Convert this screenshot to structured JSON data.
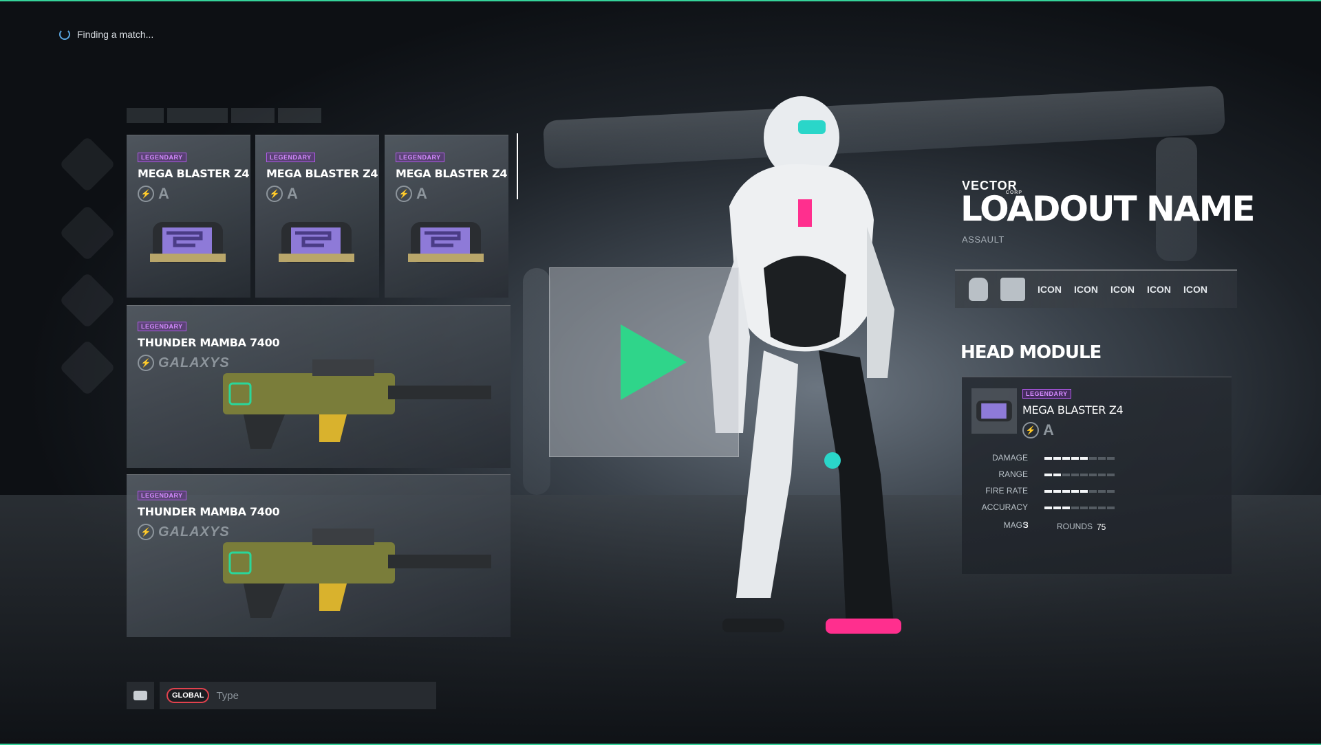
{
  "status": {
    "text": "Finding a match..."
  },
  "tabs": [
    "",
    "",
    "",
    ""
  ],
  "weapons": [
    {
      "rarity": "LEGENDARY",
      "name": "MEGA BLASTER Z4",
      "brand_letter": "A"
    },
    {
      "rarity": "LEGENDARY",
      "name": "MEGA BLASTER Z4",
      "brand_letter": "A"
    },
    {
      "rarity": "LEGENDARY",
      "name": "MEGA BLASTER Z4",
      "brand_letter": "A"
    },
    {
      "rarity": "LEGENDARY",
      "name": "THUNDER MAMBA 7400",
      "brand_logo": "GALAXYS"
    },
    {
      "rarity": "LEGENDARY",
      "name": "THUNDER MAMBA 7400",
      "brand_logo": "GALAXYS"
    }
  ],
  "brand": {
    "name": "VECTOR",
    "sub": "CORP"
  },
  "loadout": {
    "title": "LOADOUT NAME",
    "class": "ASSAULT"
  },
  "icon_bar": {
    "items": [
      "ICON",
      "ICON",
      "ICON",
      "ICON",
      "ICON"
    ]
  },
  "module": {
    "heading": "HEAD MODULE",
    "rarity": "LEGENDARY",
    "name": "MEGA BLASTER Z4",
    "brand_letter": "A",
    "stats": [
      {
        "label": "DAMAGE",
        "level": 5,
        "max": 8
      },
      {
        "label": "RANGE",
        "level": 2,
        "max": 8
      },
      {
        "label": "FIRE RATE",
        "level": 5,
        "max": 8
      },
      {
        "label": "ACCURACY",
        "level": 3,
        "max": 8
      }
    ],
    "mags_label": "MAGS",
    "mags_value": "3",
    "rounds_label": "ROUNDS",
    "rounds_value": "75"
  },
  "chat": {
    "channel": "GLOBAL",
    "placeholder": "Type"
  },
  "colors": {
    "accent": "#2fd58a",
    "legendary": "#b05ae8",
    "channel": "#e2424e",
    "mech_accent": "#ff2f8e",
    "teal": "#2ad6c9"
  },
  "icons": [
    "spinner-icon",
    "bolt-icon",
    "play-icon",
    "chat-icon",
    "helmet-icon",
    "armor-icon"
  ]
}
